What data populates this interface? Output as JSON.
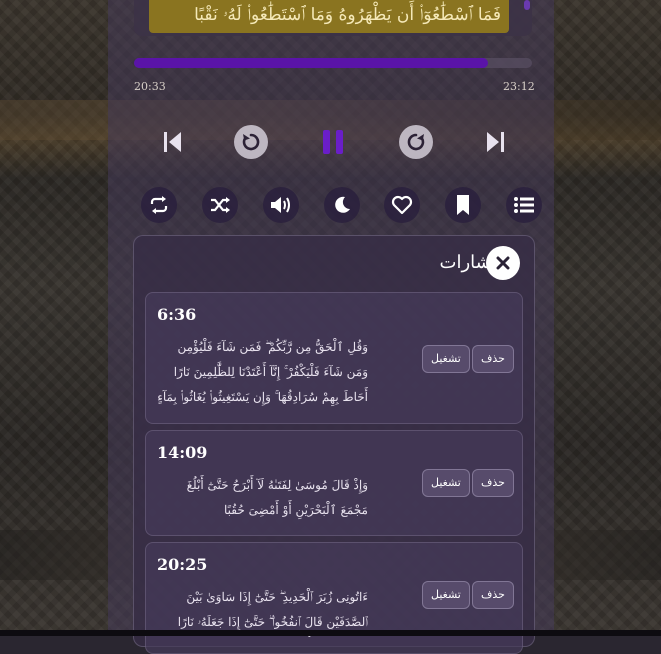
{
  "verse": {
    "current_text": "فَمَا ٱسْطَٰعُوٓا۟ أَن يَظْهَرُوهُ وَمَا ٱسْتَطَٰعُوا۟ لَهُۥ نَقْبًا"
  },
  "player": {
    "elapsed": "20:33",
    "duration": "23:12",
    "progress_fraction": 0.89
  },
  "controls": {
    "previous": "skip-previous-icon",
    "rewind": "rewind-icon",
    "pause": "pause-icon",
    "forward": "forward-icon",
    "next": "skip-next-icon"
  },
  "toolbar": {
    "items": [
      "repeat-icon",
      "shuffle-icon",
      "volume-icon",
      "moon-icon",
      "heart-icon",
      "bookmark-icon",
      "list-icon"
    ]
  },
  "bookmarks": {
    "title": "الإشارات",
    "play_label": "تشغيل",
    "delete_label": "حذف",
    "items": [
      {
        "time": "6:36",
        "text": "وَقُلِ ٱلْحَقُّ مِن رَّبِّكُمْ ۖ فَمَن شَآءَ فَلْيُؤْمِن وَمَن شَآءَ فَلْيَكْفُرْ ۚ إِنَّآ أَعْتَدْنَا لِلظَّٰلِمِينَ نَارًا أَحَاطَ بِهِمْ سُرَادِقُهَا ۚ وَإِن يَسْتَغِيثُوا۟ يُغَاثُوا۟ بِمَآءٍ كَٱلْمُهْلِ يَشْوِى ٱلْوُجُوهَ ۚ بِئْسَ ٱلشَّرَابُ وَسَآءَتْ مُرْتَفَقًا"
      },
      {
        "time": "14:09",
        "text": "وَإِذْ قَالَ مُوسَىٰ لِفَتَىٰهُ لَآ أَبْرَحُ حَتَّىٰٓ أَبْلُغَ مَجْمَعَ ٱلْبَحْرَيْنِ أَوْ أَمْضِىَ حُقُبًا"
      },
      {
        "time": "20:25",
        "text": "ءَاتُونِى زُبَرَ ٱلْحَدِيدِ ۖ حَتَّىٰٓ إِذَا سَاوَىٰ بَيْنَ ٱلصَّدَفَيْنِ قَالَ ٱنفُخُوا۟ ۖ حَتَّىٰٓ إِذَا جَعَلَهُۥ نَارًا قَالَ ءَاتُونِىٓ أُفْرِغْ عَلَيْهِ قِطْرًا"
      }
    ]
  }
}
